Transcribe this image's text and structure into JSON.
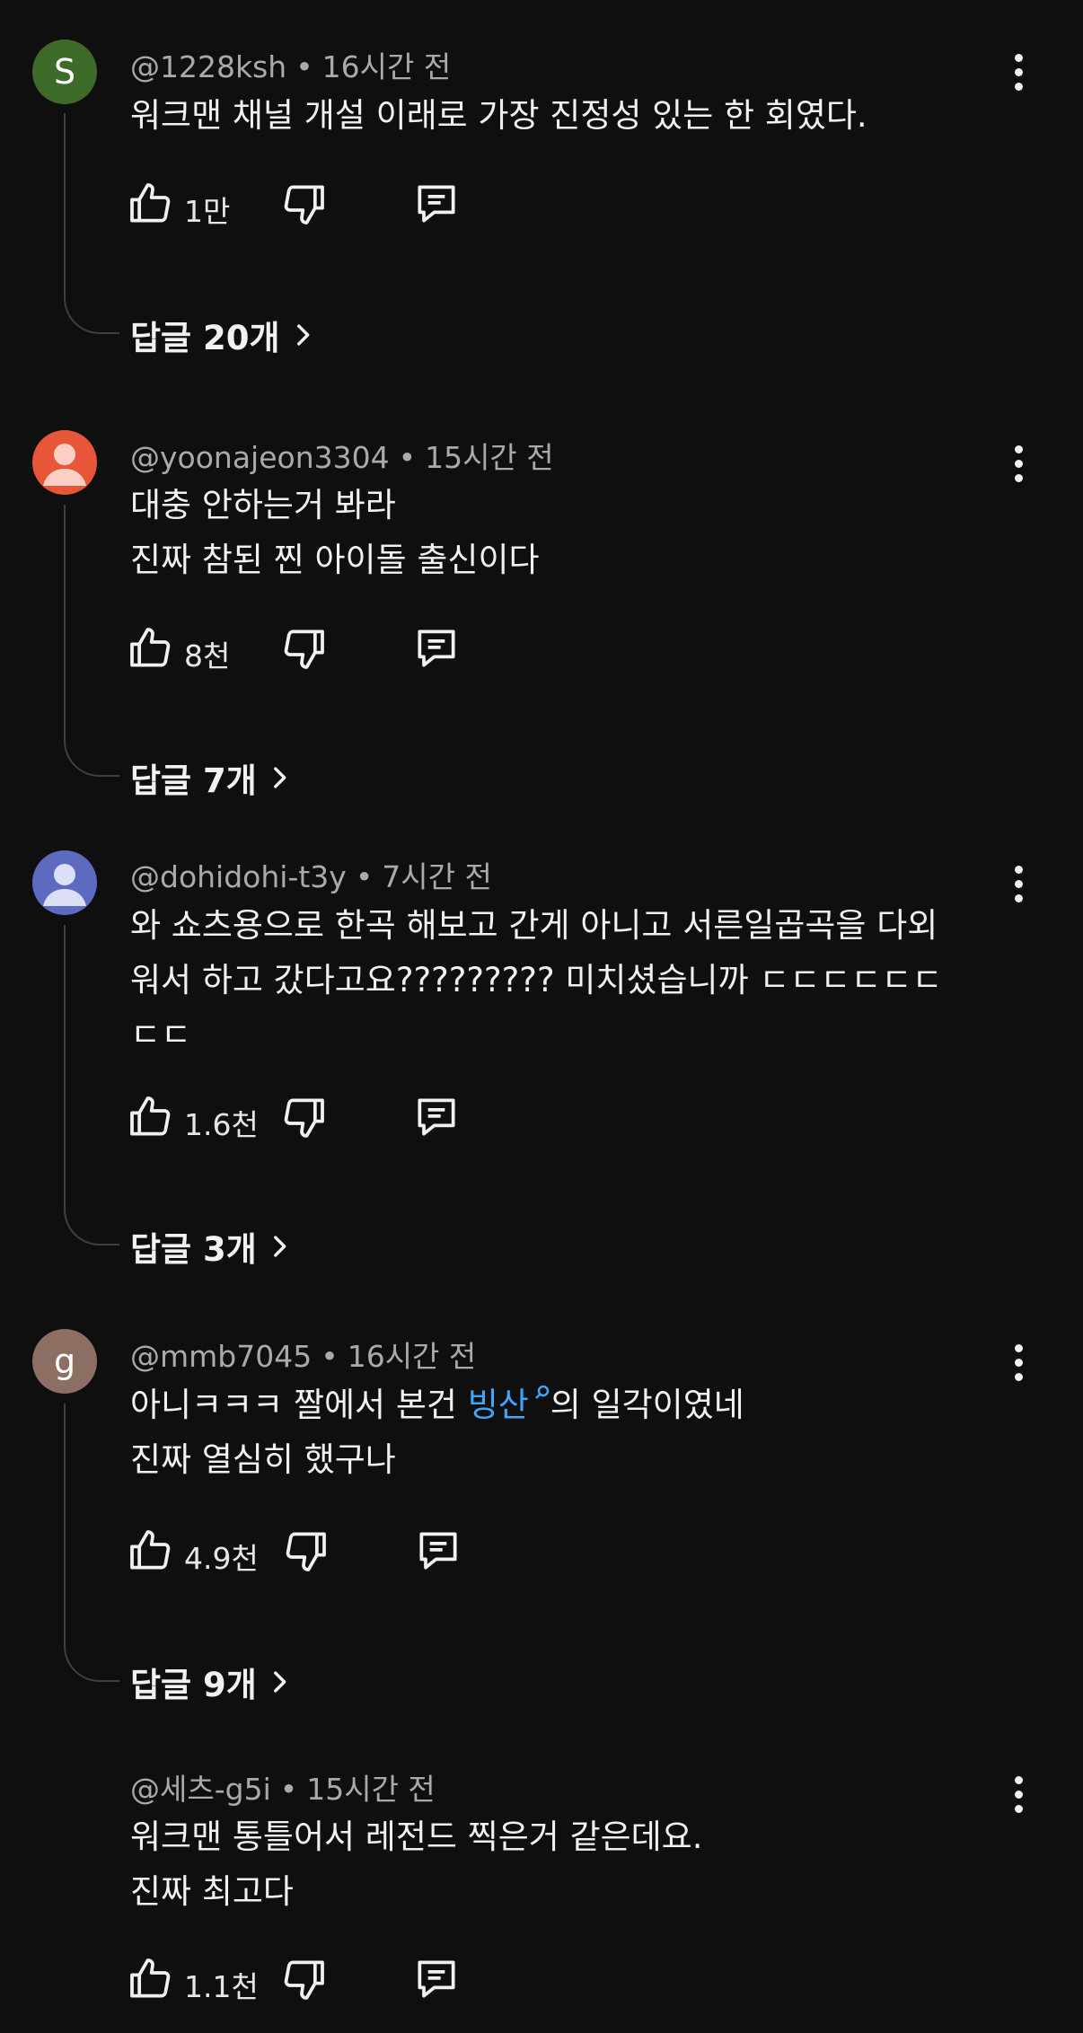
{
  "comments": [
    {
      "avatar_letter": "S",
      "avatar_color": "#3f6b2a",
      "handle": "@1228ksh",
      "time": "16시간 전",
      "lines": [
        "워크맨 채널 개설 이래로 가장 진정성 있는 한 회였다."
      ],
      "likes": "1만",
      "replies": "답글 20개"
    },
    {
      "avatar_color": "#e8563a",
      "handle": "@yoonajeon3304",
      "time": "15시간 전",
      "lines": [
        "대충 안하는거 봐라",
        "진짜 참된 찐 아이돌 출신이다"
      ],
      "likes": "8천",
      "replies": "답글 7개"
    },
    {
      "avatar_color": "#5c6bc0",
      "handle": "@dohidohi-t3y",
      "time": "7시간 전",
      "lines": [
        "와 쇼츠용으로 한곡 해보고 간게 아니고 서른일곱곡을 다외",
        "워서 하고 갔다고요????????? 미치셨습니까 ㄷㄷㄷㄷㄷㄷ",
        "ㄷㄷ"
      ],
      "likes": "1.6천",
      "replies": "답글 3개"
    },
    {
      "avatar_letter": "g",
      "avatar_color": "#8d6e63",
      "handle": "@mmb7045",
      "time": "16시간 전",
      "line1_before": "아니ㅋㅋㅋ 짤에서 본건 ",
      "line1_link": "빙산",
      "line1_after": "의 일각이였네",
      "line2": "진짜 열심히 했구나",
      "likes": "4.9천",
      "replies": "답글 9개"
    },
    {
      "handle": "@세츠-g5i",
      "time": "15시간 전",
      "lines": [
        "워크맨 통틀어서 레전드 찍은거 같은데요.",
        "진짜 최고다"
      ],
      "likes": "1.1천"
    }
  ]
}
